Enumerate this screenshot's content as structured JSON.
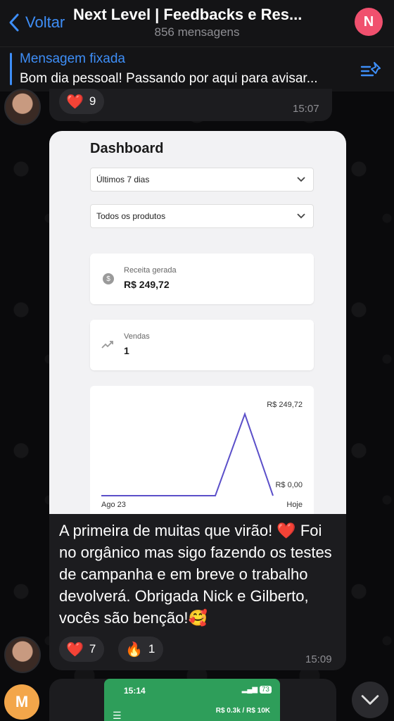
{
  "header": {
    "back_label": "Voltar",
    "title": "Next Level | Feedbacks e Res...",
    "subtitle": "856 mensagens",
    "avatar_initial": "N"
  },
  "pinned": {
    "label": "Mensagem fixada",
    "text": "Bom dia pessoal! Passando por aqui para avisar..."
  },
  "prev_message": {
    "reaction_emoji": "❤️",
    "reaction_count": "9",
    "time": "15:07"
  },
  "main_message": {
    "dashboard": {
      "title": "Dashboard",
      "filter_period": "Últimos 7 dias",
      "filter_products": "Todos os produtos",
      "revenue_label": "Receita gerada",
      "revenue_value": "R$ 249,72",
      "sales_label": "Vendas",
      "sales_value": "1"
    },
    "text": "A primeira de muitas que virão! ❤️ Foi no orgânico mas sigo fazendo os testes de campanha e em breve o trabalho devolverá. Obrigada Nick e Gilberto, vocês são benção!🥰",
    "reactions": [
      {
        "emoji": "❤️",
        "count": "7"
      },
      {
        "emoji": "🔥",
        "count": "1"
      }
    ],
    "time": "15:09"
  },
  "chart_data": {
    "type": "line",
    "x": [
      "Ago 23",
      "",
      "",
      "",
      "",
      "",
      "Hoje"
    ],
    "values": [
      0,
      0,
      0,
      0,
      0,
      249.72,
      0
    ],
    "max_label": "R$ 249,72",
    "min_label": "R$ 0,00",
    "x_start_label": "Ago 23",
    "x_end_label": "Hoje",
    "ylim": [
      0,
      249.72
    ],
    "color": "#5b4fc9"
  },
  "next_message": {
    "avatar_initial": "M",
    "phone_time": "15:14",
    "phone_battery": "73",
    "phone_revenue": "R$ 0.3k / R$ 10K"
  }
}
